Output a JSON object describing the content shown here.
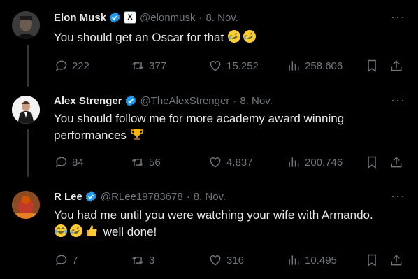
{
  "tweets": [
    {
      "name": "Elon Musk",
      "affiliate_badge": "X",
      "handle": "@elonmusk",
      "date": "8. Nov.",
      "text": "You should get an Oscar for that",
      "emojis": [
        "rolling-on-floor-laughing-emoji",
        "rolling-on-floor-laughing-emoji"
      ],
      "replies": "222",
      "reposts": "377",
      "likes": "15.252",
      "views": "258.606"
    },
    {
      "name": "Alex Strenger",
      "handle": "@TheAlexStrenger",
      "date": "8. Nov.",
      "text": "You should follow me for more academy award winning performances",
      "emojis": [
        "trophy-emoji"
      ],
      "replies": "84",
      "reposts": "56",
      "likes": "4.837",
      "views": "200.746"
    },
    {
      "name": "R Lee",
      "handle": "@RLee19783678",
      "date": "8. Nov.",
      "text_line1": "You had me until you were watching your wife with Armando.",
      "text_line2": "well done!",
      "emojis": [
        "tears-of-joy-emoji",
        "rolling-on-floor-laughing-emoji",
        "thumbs-up-emoji"
      ],
      "replies": "7",
      "reposts": "3",
      "likes": "316",
      "views": "10.495"
    }
  ],
  "separator": "·",
  "more_glyph": "···",
  "colors": {
    "background": "#000000",
    "text": "#e7e9ea",
    "muted": "#71767b",
    "verified": "#1d9bf0"
  }
}
